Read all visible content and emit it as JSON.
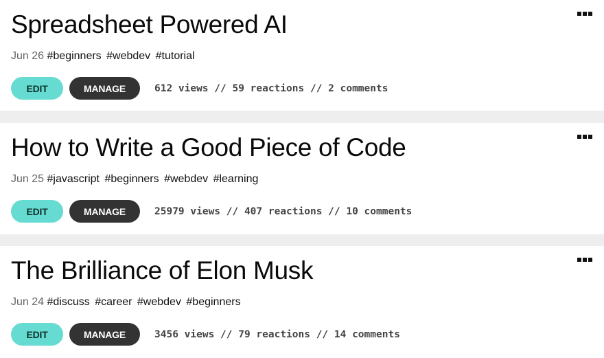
{
  "posts": [
    {
      "title": "Spreadsheet Powered AI",
      "date": "Jun 26",
      "tags": [
        "#beginners",
        "#webdev",
        "#tutorial"
      ],
      "edit_label": "EDIT",
      "manage_label": "MANAGE",
      "stats": "612 views // 59 reactions // 2 comments",
      "menu_icon": "more-horizontal-icon"
    },
    {
      "title": "How to Write a Good Piece of Code",
      "date": "Jun 25",
      "tags": [
        "#javascript",
        "#beginners",
        "#webdev",
        "#learning"
      ],
      "edit_label": "EDIT",
      "manage_label": "MANAGE",
      "stats": "25979 views // 407 reactions // 10 comments",
      "menu_icon": "more-horizontal-icon"
    },
    {
      "title": "The Brilliance of Elon Musk",
      "date": "Jun 24",
      "tags": [
        "#discuss",
        "#career",
        "#webdev",
        "#beginners"
      ],
      "edit_label": "EDIT",
      "manage_label": "MANAGE",
      "stats": "3456 views // 79 reactions // 14 comments",
      "menu_icon": "more-horizontal-icon"
    }
  ],
  "colors": {
    "edit_button": "#66dbd1",
    "manage_button": "#333333",
    "card_background": "#ffffff",
    "separator": "#eeeeee"
  }
}
